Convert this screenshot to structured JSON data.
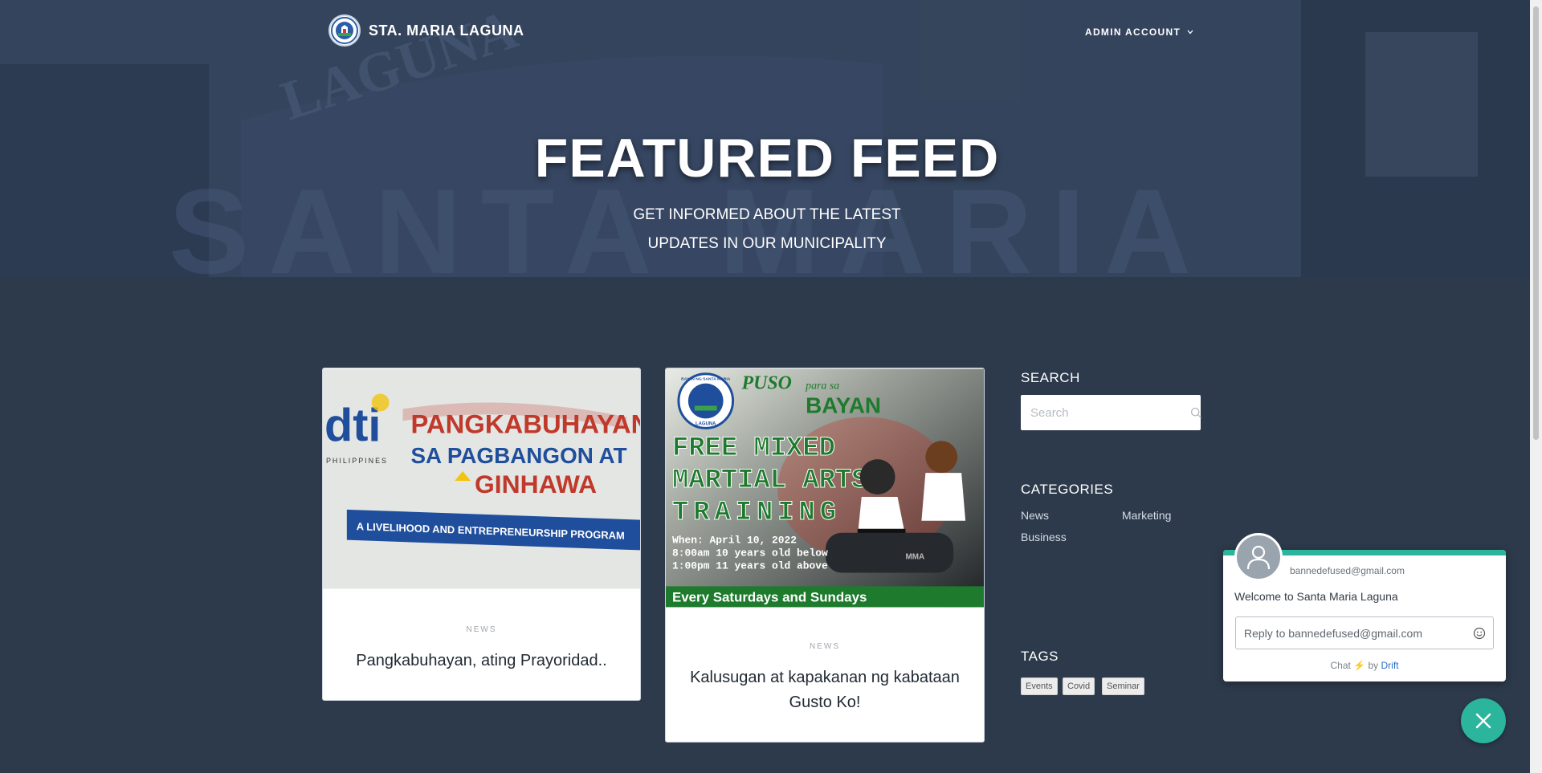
{
  "navbar": {
    "brand_name": "STA. MARIA LAGUNA",
    "account_label": "ADMIN ACCOUNT"
  },
  "hero": {
    "title": "FEATURED FEED",
    "subtitle_line1": "GET INFORMED ABOUT THE LATEST",
    "subtitle_line2": "UPDATES IN OUR MUNICIPALITY",
    "bg_letters": "SANTA MARIA",
    "bg_sign": "LAGUNA"
  },
  "posts": [
    {
      "category": "NEWS",
      "title": "Pangkabuhayan, ating Prayoridad..",
      "image": {
        "brand": "dti",
        "brand_sub": "PHILIPPINES",
        "line1": "PANGKABUHAYAN",
        "line2": "SA PAGBANGON AT",
        "line3": "GINHAWA",
        "banner": "A LIVELIHOOD AND ENTREPRENEURSHIP PROGRAM"
      }
    },
    {
      "category": "NEWS",
      "title": "Kalusugan at kapakanan ng kabataan Gusto Ko!",
      "image": {
        "seal_text": "BAYAN NG SANTA MARIA",
        "seal_sub": "LAGUNA",
        "top1": "PUSO",
        "top2": "para sa",
        "top3": "BAYAN",
        "headline1": "FREE MIXED",
        "headline2": "MARTIAL ARTS",
        "headline3": "TRAINING",
        "when": "When: April 10, 2022",
        "time1": "8:00am 10 years old below",
        "time2": "1:00pm 11 years old above",
        "footer": "Every Saturdays and Sundays",
        "bag_text": "MMA"
      }
    }
  ],
  "sidebar": {
    "search_heading": "SEARCH",
    "search_placeholder": "Search",
    "categories_heading": "CATEGORIES",
    "categories": [
      "News",
      "Marketing",
      "Business"
    ],
    "tags_heading": "TAGS",
    "tags": [
      "Events",
      "Covid",
      "Seminar"
    ]
  },
  "chat": {
    "email": "bannedefused@gmail.com",
    "welcome": "Welcome to Santa Maria Laguna",
    "reply_placeholder": "Reply to bannedefused@gmail.com",
    "footer_chat": "Chat",
    "footer_by": "by",
    "footer_brand": "Drift"
  },
  "colors": {
    "page_bg": "#2d3a4b",
    "accent": "#2bb59c",
    "drift_blue": "#2a6ec7"
  },
  "icons": [
    "search-icon",
    "chevron-down-icon",
    "user-icon",
    "emoji-icon",
    "close-icon",
    "bolt-icon"
  ]
}
